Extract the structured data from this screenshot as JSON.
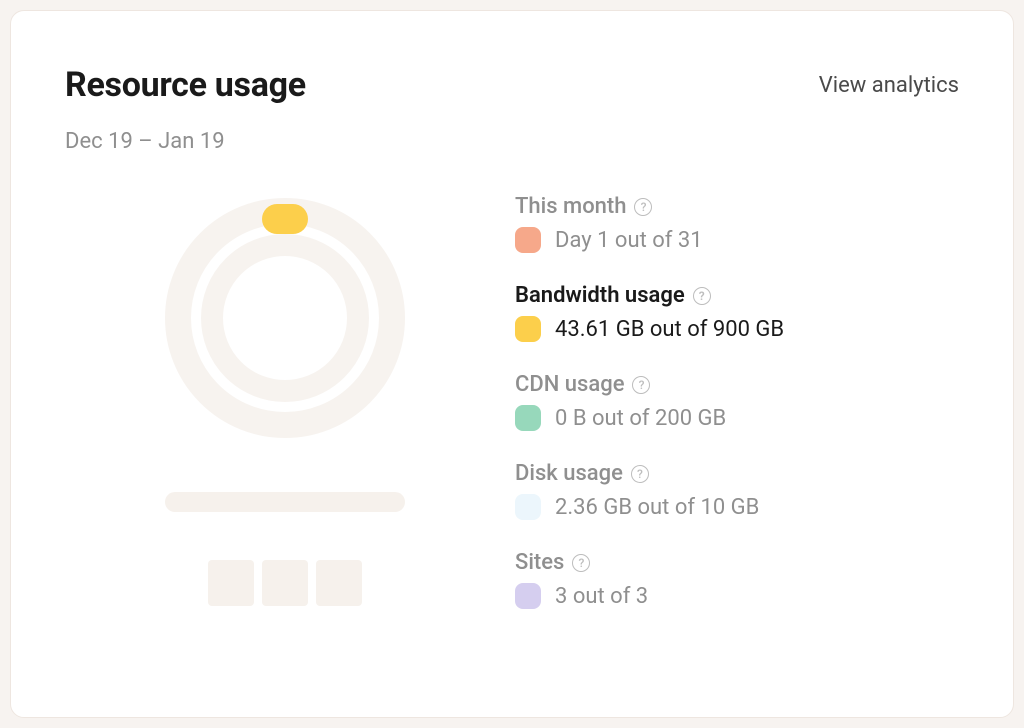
{
  "header": {
    "title": "Resource usage",
    "view_analytics": "View analytics",
    "date_range": "Dec 19 – Jan 19"
  },
  "metrics": {
    "this_month": {
      "label": "This month",
      "value": "Day 1 out of 31",
      "swatch": "orange"
    },
    "bandwidth": {
      "label": "Bandwidth usage",
      "value": "43.61 GB out of 900 GB",
      "swatch": "yellow"
    },
    "cdn": {
      "label": "CDN usage",
      "value": "0 B out of 200 GB",
      "swatch": "green"
    },
    "disk": {
      "label": "Disk usage",
      "value": "2.36 GB out of 10 GB",
      "swatch": "blue"
    },
    "sites": {
      "label": "Sites",
      "value": "3 out of 3",
      "swatch": "purple"
    }
  },
  "chart_data": {
    "type": "pie",
    "title": "Resource usage rings",
    "series": [
      {
        "name": "This month",
        "used": 1,
        "total": 31,
        "unit": "days",
        "color": "#f6a88a"
      },
      {
        "name": "Bandwidth usage",
        "used": 43.61,
        "total": 900,
        "unit": "GB",
        "color": "#fccf4b"
      },
      {
        "name": "CDN usage",
        "used": 0,
        "total": 200,
        "unit": "GB",
        "color": "#97d8bb"
      },
      {
        "name": "Disk usage",
        "used": 2.36,
        "total": 10,
        "unit": "GB",
        "color": "#ecf6fc"
      },
      {
        "name": "Sites",
        "used": 3,
        "total": 3,
        "unit": "sites",
        "color": "#d5ceef"
      }
    ]
  }
}
